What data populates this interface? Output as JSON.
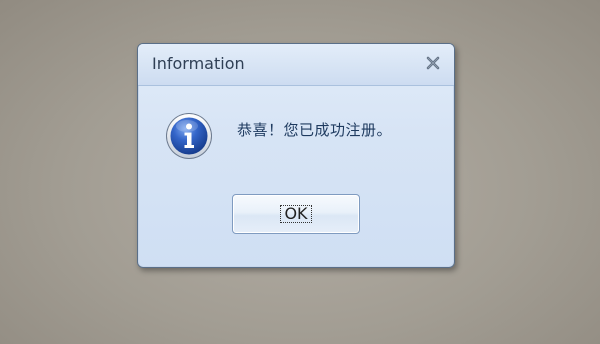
{
  "dialog": {
    "title": "Information",
    "message": "恭喜！您已成功注册。",
    "ok_label": "OK",
    "close_symbol": "X",
    "icon": "information-icon"
  },
  "colors": {
    "desktop": "#a29c92",
    "dialog_bg": "#d7e4f5",
    "dialog_border": "#5a6f88",
    "title_text": "#2f3f55",
    "message_text": "#1e3a5f",
    "icon_blue": "#2a5bbf"
  }
}
